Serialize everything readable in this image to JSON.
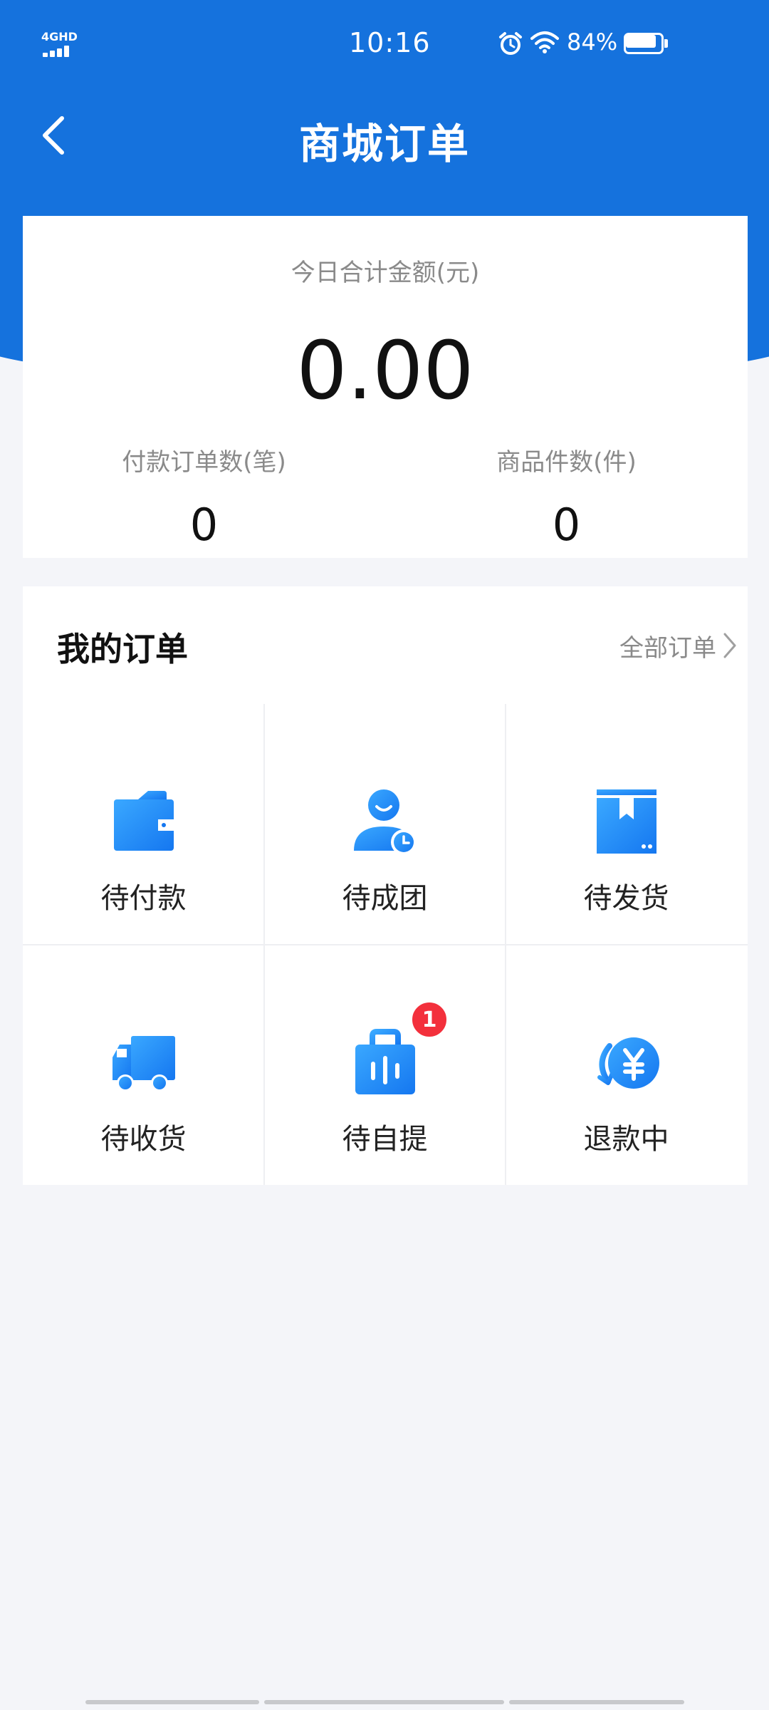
{
  "status_bar": {
    "network": "4GHD",
    "time": "10:16",
    "battery_percent": "84%",
    "battery_level": 0.84
  },
  "nav": {
    "title": "商城订单"
  },
  "summary": {
    "amount_label": "今日合计金额(元)",
    "amount_value": "0.00",
    "paid_orders_label": "付款订单数(笔)",
    "paid_orders_value": "0",
    "item_count_label": "商品件数(件)",
    "item_count_value": "0"
  },
  "orders": {
    "title": "我的订单",
    "all_orders_label": "全部订单",
    "items": [
      {
        "label": "待付款",
        "icon": "wallet-icon"
      },
      {
        "label": "待成团",
        "icon": "user-clock-icon"
      },
      {
        "label": "待发货",
        "icon": "package-box-icon"
      },
      {
        "label": "待收货",
        "icon": "delivery-truck-icon"
      },
      {
        "label": "待自提",
        "icon": "shopping-bag-icon",
        "badge": "1"
      },
      {
        "label": "退款中",
        "icon": "refund-yuan-icon"
      }
    ]
  },
  "colors": {
    "primary": "#1572dd",
    "icon_gradient_start": "#3aa8ff",
    "icon_gradient_end": "#1577f0",
    "badge": "#f3303c"
  }
}
